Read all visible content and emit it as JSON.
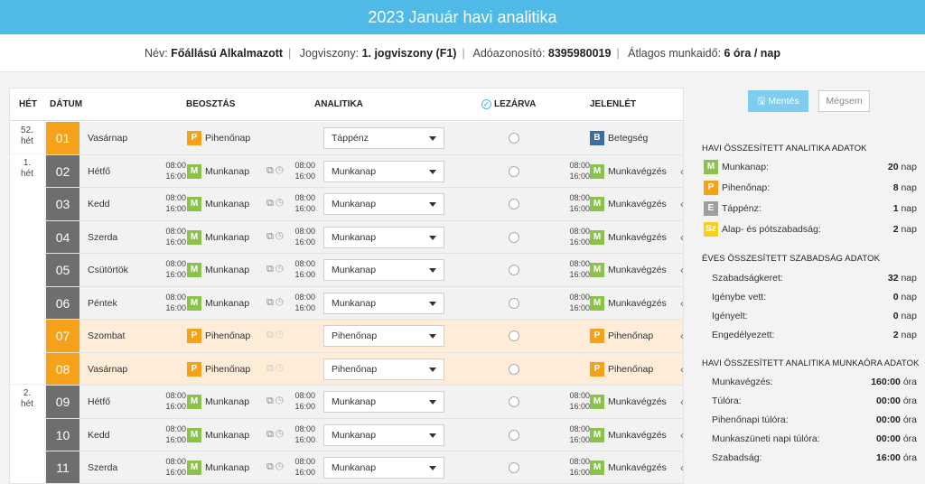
{
  "header": {
    "title": "2023 Január havi analitika"
  },
  "info": {
    "name_label": "Név:",
    "name": "Főállású Alkalmazott",
    "jog_label": "Jogviszony:",
    "jog": "1. jogviszony (F1)",
    "ado_label": "Adóazonosító:",
    "ado": "8395980019",
    "munka_label": "Átlagos munkaidő:",
    "munka": "6 óra / nap"
  },
  "columns": {
    "het": "HÉT",
    "datum": "DÁTUM",
    "beosztas": "BEOSZTÁS",
    "analitika": "ANALITIKA",
    "lezarva": "LEZÁRVA",
    "jelenlet": "JELENLÉT"
  },
  "weeks": [
    {
      "label1": "52.",
      "label2": "hét"
    },
    {
      "label1": "1.",
      "label2": "hét"
    },
    {
      "label1": "2.",
      "label2": "hét"
    }
  ],
  "rows": [
    {
      "num": "01",
      "day": "Vasárnap",
      "type": "first",
      "beo_badge": "P",
      "beo": "Pihenőnap",
      "start": "",
      "end": "",
      "select": "Táppénz",
      "jel_badge": "B",
      "jel": "Betegség"
    },
    {
      "num": "02",
      "day": "Hétfő",
      "type": "weekday",
      "beo_badge": "M",
      "beo": "Munkanap",
      "start": "08:00",
      "end": "16:00",
      "select": "Munkanap",
      "jel_badge": "M",
      "jel": "Munkavégzés"
    },
    {
      "num": "03",
      "day": "Kedd",
      "type": "weekday",
      "beo_badge": "M",
      "beo": "Munkanap",
      "start": "08:00",
      "end": "16:00",
      "select": "Munkanap",
      "jel_badge": "M",
      "jel": "Munkavégzés"
    },
    {
      "num": "04",
      "day": "Szerda",
      "type": "weekday",
      "beo_badge": "M",
      "beo": "Munkanap",
      "start": "08:00",
      "end": "16:00",
      "select": "Munkanap",
      "jel_badge": "M",
      "jel": "Munkavégzés"
    },
    {
      "num": "05",
      "day": "Csütörtök",
      "type": "weekday",
      "beo_badge": "M",
      "beo": "Munkanap",
      "start": "08:00",
      "end": "16:00",
      "select": "Munkanap",
      "jel_badge": "M",
      "jel": "Munkavégzés"
    },
    {
      "num": "06",
      "day": "Péntek",
      "type": "weekday",
      "beo_badge": "M",
      "beo": "Munkanap",
      "start": "08:00",
      "end": "16:00",
      "select": "Munkanap",
      "jel_badge": "M",
      "jel": "Munkavégzés"
    },
    {
      "num": "07",
      "day": "Szombat",
      "type": "holiday",
      "beo_badge": "P",
      "beo": "Pihenőnap",
      "start": "",
      "end": "",
      "select": "Pihenőnap",
      "jel_badge": "P",
      "jel": "Pihenőnap"
    },
    {
      "num": "08",
      "day": "Vasárnap",
      "type": "holiday",
      "beo_badge": "P",
      "beo": "Pihenőnap",
      "start": "",
      "end": "",
      "select": "Pihenőnap",
      "jel_badge": "P",
      "jel": "Pihenőnap"
    },
    {
      "num": "09",
      "day": "Hétfő",
      "type": "weekday",
      "beo_badge": "M",
      "beo": "Munkanap",
      "start": "08:00",
      "end": "16:00",
      "select": "Munkanap",
      "jel_badge": "M",
      "jel": "Munkavégzés"
    },
    {
      "num": "10",
      "day": "Kedd",
      "type": "weekday",
      "beo_badge": "M",
      "beo": "Munkanap",
      "start": "08:00",
      "end": "16:00",
      "select": "Munkanap",
      "jel_badge": "M",
      "jel": "Munkavégzés"
    },
    {
      "num": "11",
      "day": "Szerda",
      "type": "weekday",
      "beo_badge": "M",
      "beo": "Munkanap",
      "start": "08:00",
      "end": "16:00",
      "select": "Munkanap",
      "jel_badge": "M",
      "jel": "Munkavégzés"
    }
  ],
  "buttons": {
    "save": "Mentés",
    "cancel": "Mégsem"
  },
  "havi": {
    "title": "HAVI ÖSSZESÍTETT ANALITIKA ADATOK",
    "items": [
      {
        "badge": "M",
        "label": "Munkanap:",
        "value": "20",
        "unit": "nap"
      },
      {
        "badge": "P",
        "label": "Pihenőnap:",
        "value": "8",
        "unit": "nap"
      },
      {
        "badge": "E",
        "label": "Táppénz:",
        "value": "1",
        "unit": "nap"
      },
      {
        "badge": "Sz",
        "label": "Alap- és pótszabadság:",
        "value": "2",
        "unit": "nap"
      }
    ]
  },
  "eves": {
    "title": "ÉVES ÖSSZESÍTETT SZABADSÁG ADATOK",
    "items": [
      {
        "label": "Szabadságkeret:",
        "value": "32",
        "unit": "nap"
      },
      {
        "label": "Igénybe vett:",
        "value": "0",
        "unit": "nap"
      },
      {
        "label": "Igényelt:",
        "value": "0",
        "unit": "nap"
      },
      {
        "label": "Engedélyezett:",
        "value": "2",
        "unit": "nap"
      }
    ]
  },
  "munkaora": {
    "title": "HAVI ÖSSZESÍTETT ANALITIKA MUNKAÓRA ADATOK",
    "items": [
      {
        "label": "Munkavégzés:",
        "value": "160:00",
        "unit": "óra"
      },
      {
        "label": "Túlóra:",
        "value": "00:00",
        "unit": "óra"
      },
      {
        "label": "Pihenőnapi túlóra:",
        "value": "00:00",
        "unit": "óra"
      },
      {
        "label": "Munkaszüneti napi túlóra:",
        "value": "00:00",
        "unit": "óra"
      },
      {
        "label": "Szabadság:",
        "value": "16:00",
        "unit": "óra"
      }
    ]
  },
  "colors": {
    "accent": "#4fb9e8",
    "munkanap": "#8bc34a",
    "pihenonap": "#f5a11a",
    "betegseg": "#3a6ea5",
    "tappenz": "#9e9e9e",
    "szabadsag": "#f7d21a"
  }
}
